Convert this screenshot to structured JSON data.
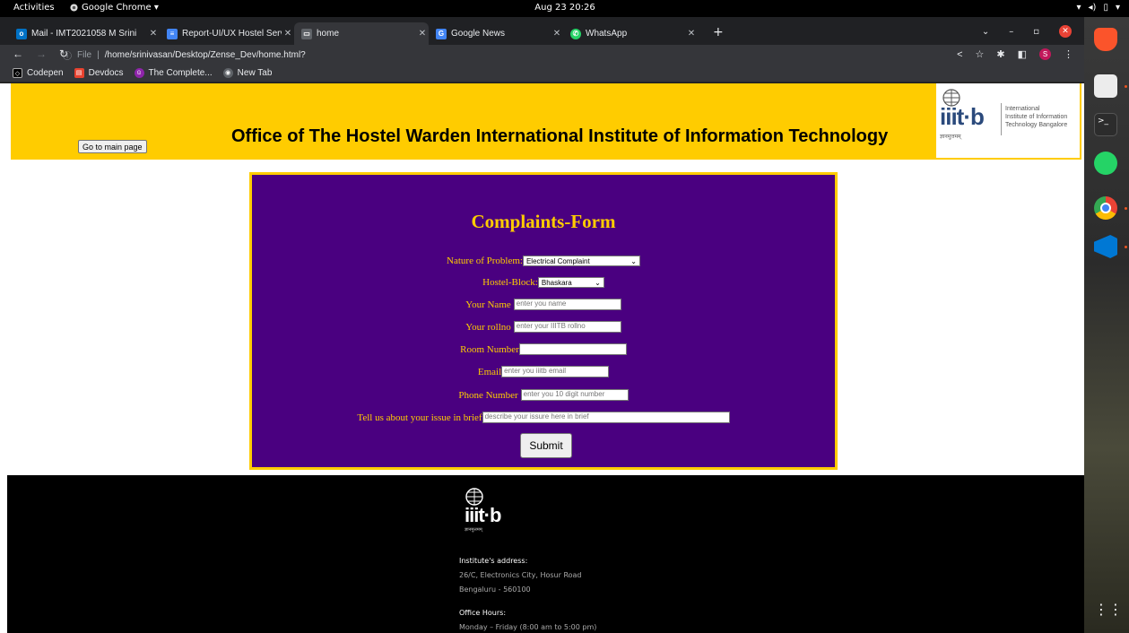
{
  "topbar": {
    "activities": "Activities",
    "app_name": "Google Chrome ▾",
    "clock": "Aug 23  20:26"
  },
  "tabs": [
    {
      "title": "Mail - IMT2021058 M Srini",
      "favicon_color": "#0072c6",
      "favicon_glyph": "o"
    },
    {
      "title": "Report-UI/UX Hostel Serv",
      "favicon_color": "#4285f4",
      "favicon_glyph": "≡"
    },
    {
      "title": "home",
      "favicon_color": "#5f6368",
      "favicon_glyph": "▭"
    },
    {
      "title": "Google News",
      "favicon_color": "#4285f4",
      "favicon_glyph": "G"
    },
    {
      "title": "WhatsApp",
      "favicon_color": "#25d366",
      "favicon_glyph": "✆"
    }
  ],
  "toolbar": {
    "scheme": "File",
    "url": "/home/srinivasan/Desktop/Zense_Dev/home.html?",
    "profile_initial": "S"
  },
  "bookmarks": [
    {
      "label": "Codepen",
      "color": "#000"
    },
    {
      "label": "Devdocs",
      "color": "#e8422f"
    },
    {
      "label": "The Complete...",
      "color": "#8e24aa"
    },
    {
      "label": "New Tab",
      "color": "#5f6368"
    }
  ],
  "header": {
    "main_button": "Go to main page",
    "title": "Office of The Hostel Warden International Institute of Information Technology",
    "logo_word": "iiit·b",
    "logo_line1": "International",
    "logo_line2": "Institute of Information",
    "logo_line3": "Technology Bangalore",
    "logo_hindi": "ज्ञानमुत्तमम्",
    "bg_color": "#ffcc00"
  },
  "form": {
    "title": "Complaints-Form",
    "problem_label": "Nature of Problem:",
    "problem_value": "Electrical Complaint",
    "block_label": "Hostel-Block:",
    "block_value": "Bhaskara",
    "name_label": "Your Name",
    "name_placeholder": "enter you name",
    "rollno_label": "Your rollno",
    "rollno_placeholder": "enter your IIITB rollno",
    "room_label": "Room Number",
    "room_placeholder": "",
    "email_label": "Email",
    "email_placeholder": "enter you iiitb email",
    "phone_label": "Phone Number",
    "phone_placeholder": "enter you 10 digit number",
    "issue_label": "Tell us about your issue in brief",
    "issue_placeholder": "describe your issure here in brief",
    "submit": "Submit",
    "bg_color": "#4a0080"
  },
  "footer": {
    "logo_word": "iiit·b",
    "logo_hindi": "ज्ञानमुत्तमम्",
    "address_heading": "Institute's address:",
    "address_line1": "26/C, Electronics City, Hosur Road",
    "address_line2": "Bengaluru - 560100",
    "hours_heading": "Office Hours:",
    "hours_line": "Monday – Friday (8:00 am to 5:00 pm)"
  },
  "dock": [
    "brave-icon",
    "files-icon",
    "terminal-icon",
    "whatsapp-icon",
    "chrome-icon",
    "vscode-icon",
    "app-grid-icon"
  ]
}
